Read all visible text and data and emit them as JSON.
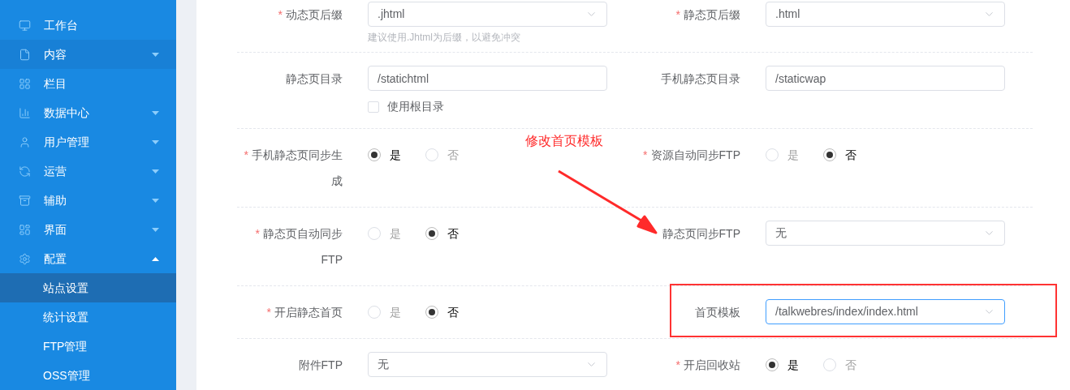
{
  "sidebar": {
    "items": [
      {
        "label": "工作台",
        "kind": "link",
        "hovered": false
      },
      {
        "label": "内容",
        "kind": "group",
        "expanded": false,
        "hovered": true
      },
      {
        "label": "栏目",
        "kind": "link",
        "hovered": false
      },
      {
        "label": "数据中心",
        "kind": "group",
        "expanded": false,
        "hovered": false
      },
      {
        "label": "用户管理",
        "kind": "group",
        "expanded": false,
        "hovered": false
      },
      {
        "label": "运营",
        "kind": "group",
        "expanded": false,
        "hovered": false
      },
      {
        "label": "辅助",
        "kind": "group",
        "expanded": false,
        "hovered": false
      },
      {
        "label": "界面",
        "kind": "group",
        "expanded": false,
        "hovered": false
      },
      {
        "label": "配置",
        "kind": "group",
        "expanded": true,
        "hovered": false,
        "children": [
          {
            "label": "站点设置",
            "selected": true
          },
          {
            "label": "统计设置",
            "selected": false
          },
          {
            "label": "FTP管理",
            "selected": false
          },
          {
            "label": "OSS管理",
            "selected": false
          }
        ]
      }
    ]
  },
  "form": {
    "rows": [
      {
        "fields": [
          {
            "label": "动态页后缀",
            "required_mark": "*",
            "kind": "select",
            "value": ".jhtml",
            "focused": false,
            "hint": "建议使用.Jhtml为后缀，以避免冲突"
          },
          {
            "label": "静态页后缀",
            "required_mark": "*",
            "kind": "select",
            "value": ".html",
            "focused": false
          }
        ]
      },
      {
        "fields": [
          {
            "label": "静态页目录",
            "kind": "text",
            "value": "/statichtml",
            "checkbox": {
              "label": "使用根目录",
              "checked": false
            }
          },
          {
            "label": "手机静态页目录",
            "kind": "text",
            "value": "/staticwap"
          }
        ]
      },
      {
        "fields": [
          {
            "label": "手机静态页同步生成",
            "required_mark": "*",
            "kind": "radio",
            "options": [
              {
                "label": "是",
                "selected": true
              },
              {
                "label": "否",
                "selected": false
              }
            ]
          },
          {
            "label": "资源自动同步FTP",
            "required_mark": "*",
            "kind": "radio",
            "options": [
              {
                "label": "是",
                "selected": false
              },
              {
                "label": "否",
                "selected": true
              }
            ]
          }
        ]
      },
      {
        "fields": [
          {
            "label": "静态页自动同步FTP",
            "required_mark": "*",
            "kind": "radio",
            "options": [
              {
                "label": "是",
                "selected": false
              },
              {
                "label": "否",
                "selected": true
              }
            ]
          },
          {
            "label": "静态页同步FTP",
            "kind": "select",
            "value": "无",
            "focused": false
          }
        ]
      },
      {
        "fields": [
          {
            "label": "开启静态首页",
            "required_mark": "*",
            "kind": "radio",
            "options": [
              {
                "label": "是",
                "selected": false
              },
              {
                "label": "否",
                "selected": true
              }
            ]
          },
          {
            "label": "首页模板",
            "kind": "select",
            "value": "/talkwebres/index/index.html",
            "focused": true
          }
        ]
      },
      {
        "fields": [
          {
            "label": "附件FTP",
            "kind": "select",
            "value": "无",
            "focused": false
          },
          {
            "label": "开启回收站",
            "required_mark": "*",
            "kind": "radio",
            "options": [
              {
                "label": "是",
                "selected": true
              },
              {
                "label": "否",
                "selected": false
              }
            ]
          }
        ]
      }
    ]
  },
  "annotation": {
    "text": "修改首页模板"
  }
}
